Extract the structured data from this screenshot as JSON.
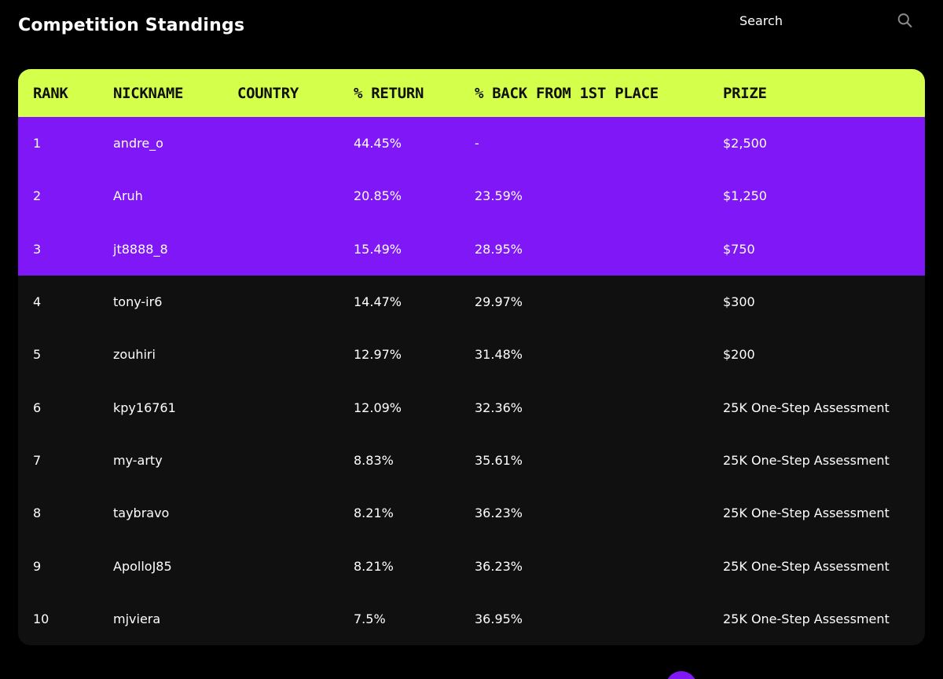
{
  "page": {
    "title": "Competition Standings"
  },
  "search": {
    "placeholder": "Search"
  },
  "table": {
    "columns": [
      "RANK",
      "NICKNAME",
      "COUNTRY",
      "% RETURN",
      "% BACK FROM 1ST PLACE",
      "PRIZE"
    ],
    "rows": [
      {
        "rank": "1",
        "nickname": "andre_o",
        "country": "",
        "return": "44.45%",
        "back": "-",
        "prize": "$2,500"
      },
      {
        "rank": "2",
        "nickname": "Aruh",
        "country": "",
        "return": "20.85%",
        "back": "23.59%",
        "prize": "$1,250"
      },
      {
        "rank": "3",
        "nickname": "jt8888_8",
        "country": "",
        "return": "15.49%",
        "back": "28.95%",
        "prize": "$750"
      },
      {
        "rank": "4",
        "nickname": "tony-ir6",
        "country": "",
        "return": "14.47%",
        "back": "29.97%",
        "prize": "$300"
      },
      {
        "rank": "5",
        "nickname": "zouhiri",
        "country": "",
        "return": "12.97%",
        "back": "31.48%",
        "prize": "$200"
      },
      {
        "rank": "6",
        "nickname": "kpy16761",
        "country": "",
        "return": "12.09%",
        "back": "32.36%",
        "prize": "25K One-Step Assessment"
      },
      {
        "rank": "7",
        "nickname": "my-arty",
        "country": "",
        "return": "8.83%",
        "back": "35.61%",
        "prize": "25K One-Step Assessment"
      },
      {
        "rank": "8",
        "nickname": "taybravo",
        "country": "",
        "return": "8.21%",
        "back": "36.23%",
        "prize": "25K One-Step Assessment"
      },
      {
        "rank": "9",
        "nickname": "ApolloJ85",
        "country": "",
        "return": "8.21%",
        "back": "36.23%",
        "prize": "25K One-Step Assessment"
      },
      {
        "rank": "10",
        "nickname": "mjviera",
        "country": "",
        "return": "7.5%",
        "back": "36.95%",
        "prize": "25K One-Step Assessment"
      }
    ]
  },
  "colors": {
    "background": "#000000",
    "header_accent": "#d4ff4a",
    "podium_rows": "#7f17f7",
    "table_body": "#101010"
  },
  "icons": {
    "search": "search-icon"
  }
}
